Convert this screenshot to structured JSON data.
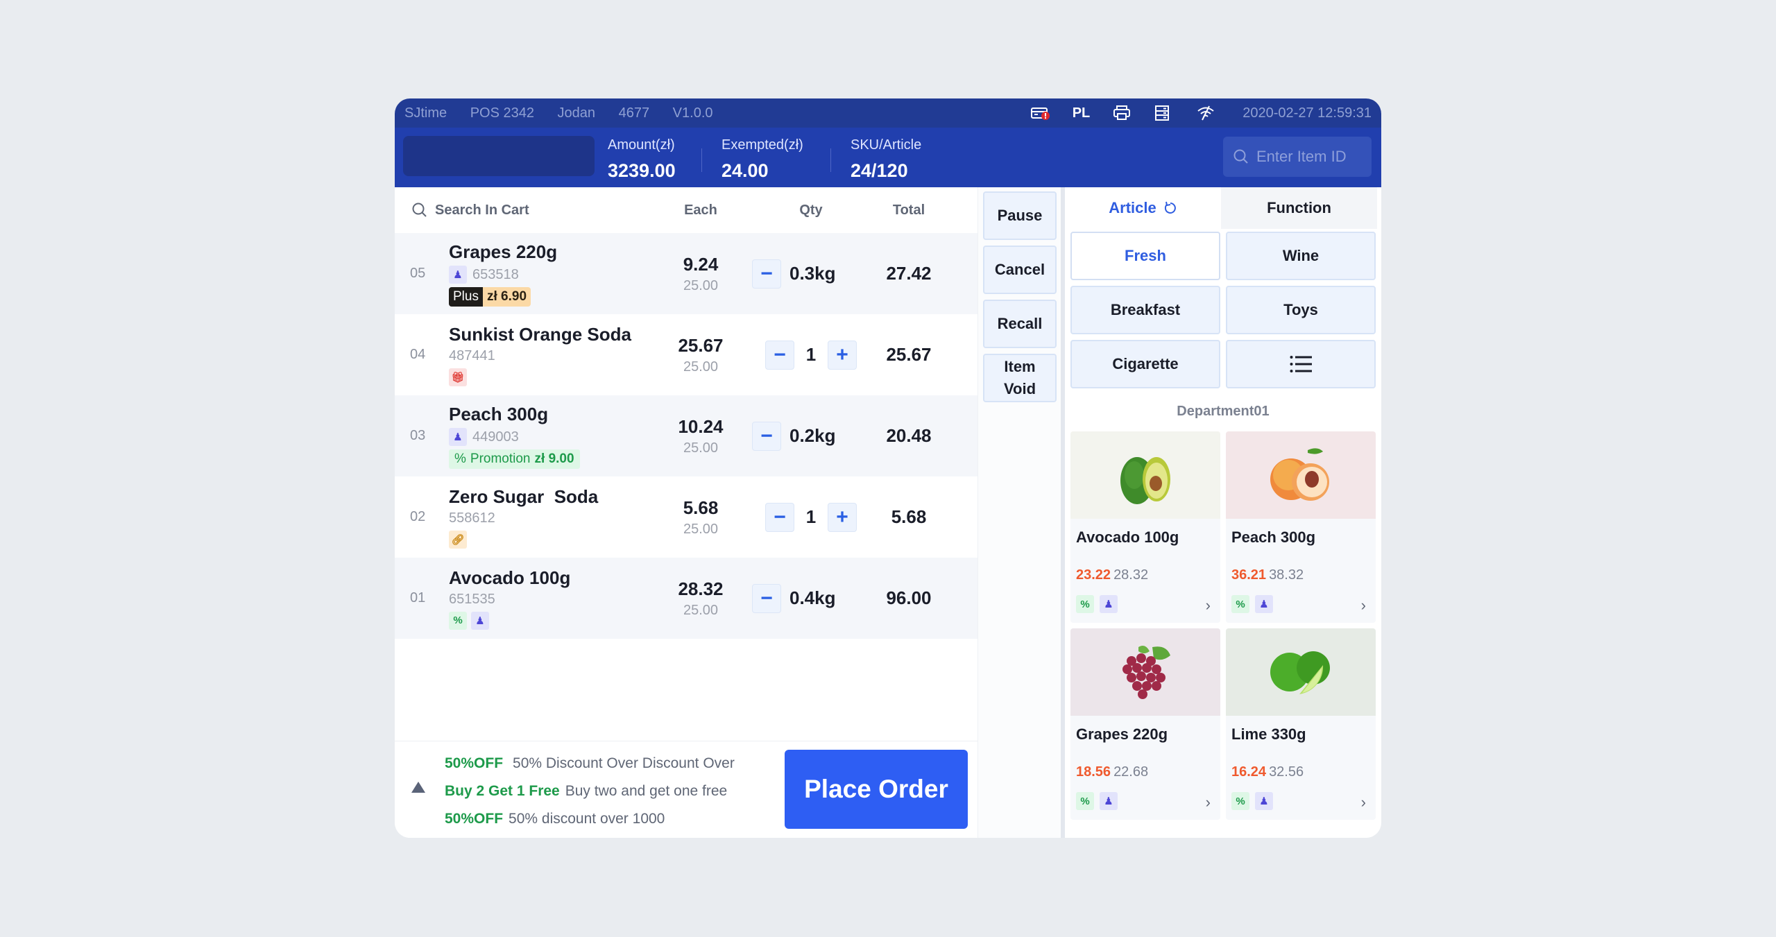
{
  "topbar": {
    "store": "SJtime",
    "pos": "POS 2342",
    "cashier": "Jodan",
    "cashier_id": "4677",
    "version": "V1.0.0",
    "language": "PL",
    "datetime": "2020-02-27 12:59:31",
    "icons": [
      "cash-drawer-alert-icon",
      "printer-icon",
      "server-icon",
      "wifi-off-icon"
    ]
  },
  "header": {
    "amount_label": "Amount(zł)",
    "amount_value": "3239.00",
    "exempted_label": "Exempted(zł)",
    "exempted_value": "24.00",
    "sku_label": "SKU/Article",
    "sku_value": "24/120",
    "item_search_placeholder": "Enter Item ID"
  },
  "cart": {
    "search_label": "Search In Cart",
    "columns": {
      "each": "Each",
      "qty": "Qty",
      "total": "Total"
    },
    "rows": [
      {
        "index": "05",
        "name": "Grapes 220g",
        "sku": "653518",
        "each": "9.24",
        "orig": "25.00",
        "qty": "0.3kg",
        "total": "27.42",
        "plus_label": "Plus",
        "plus_price": "zł 6.90"
      },
      {
        "index": "04",
        "name": "Sunkist Orange Soda",
        "sku": "487441",
        "each": "25.67",
        "orig": "25.00",
        "qty": "1",
        "total": "25.67"
      },
      {
        "index": "03",
        "name": "Peach 300g",
        "sku": "449003",
        "each": "10.24",
        "orig": "25.00",
        "qty": "0.2kg",
        "total": "20.48",
        "promo_label": "Promotion",
        "promo_price": "zł 9.00"
      },
      {
        "index": "02",
        "name": "Zero Sugar  Soda",
        "sku": "558612",
        "each": "5.68",
        "orig": "25.00",
        "qty": "1",
        "total": "5.68"
      },
      {
        "index": "01",
        "name": "Avocado 100g",
        "sku": "651535",
        "each": "28.32",
        "orig": "25.00",
        "qty": "0.4kg",
        "total": "96.00"
      }
    ],
    "stepper": {
      "minus": "−",
      "plus": "+"
    }
  },
  "promotions": [
    {
      "key": "50%OFF",
      "desc": "50% Discount Over Discount Over"
    },
    {
      "key": "Buy 2 Get 1 Free",
      "desc": "Buy two and get one free"
    },
    {
      "key": "50%OFF",
      "desc": "50% discount over 1000"
    }
  ],
  "place_order_label": "Place Order",
  "actions": {
    "pause": "Pause",
    "cancel": "Cancel",
    "recall": "Recall",
    "item_void_1": "Item",
    "item_void_2": "Void"
  },
  "catalog": {
    "tabs": {
      "article": "Article",
      "function": "Function"
    },
    "categories": [
      "Fresh",
      "Wine",
      "Breakfast",
      "Toys",
      "Cigarette"
    ],
    "selected_category": "Fresh",
    "department": "Department01",
    "products": [
      {
        "name": "Avocado 100g",
        "sale": "23.22",
        "price": "28.32"
      },
      {
        "name": "Peach 300g",
        "sale": "36.21",
        "price": "38.32"
      },
      {
        "name": "Grapes 220g",
        "sale": "18.56",
        "price": "22.68"
      },
      {
        "name": "Lime 330g",
        "sale": "16.24",
        "price": "32.56"
      }
    ]
  },
  "colors": {
    "primary": "#213fae",
    "topbar": "#213b94",
    "accent": "#2e5ef3",
    "sale": "#ef5a2e",
    "promo_green": "#1d9a4a"
  }
}
